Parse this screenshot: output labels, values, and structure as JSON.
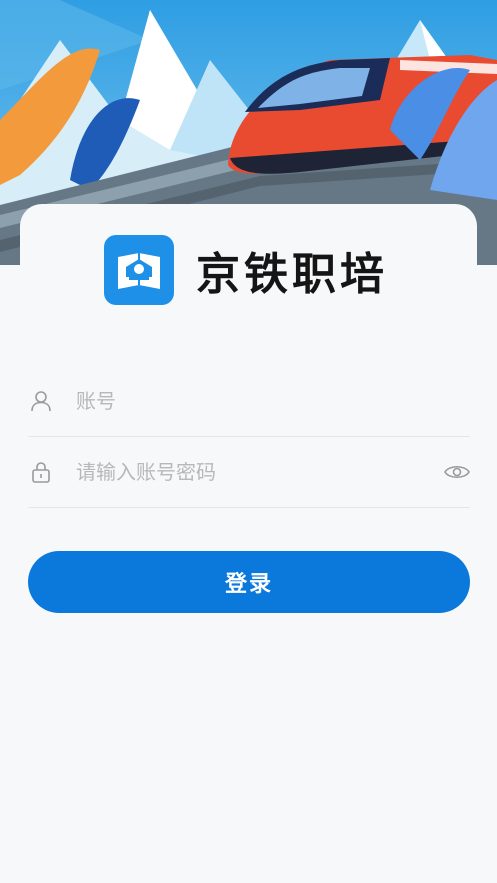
{
  "brand": {
    "name": "京铁职培",
    "logo_icon": "book-temple-icon"
  },
  "login_form": {
    "account": {
      "placeholder": "账号",
      "icon": "user-icon"
    },
    "password": {
      "placeholder": "请输入账号密码",
      "icon": "lock-icon",
      "toggle_icon": "eye-icon"
    },
    "submit_label": "登录"
  },
  "colors": {
    "primary": "#0b79dc",
    "logo_bg": "#1e90e8",
    "background": "#f7f8fa",
    "sky": "#3aa3e2"
  }
}
